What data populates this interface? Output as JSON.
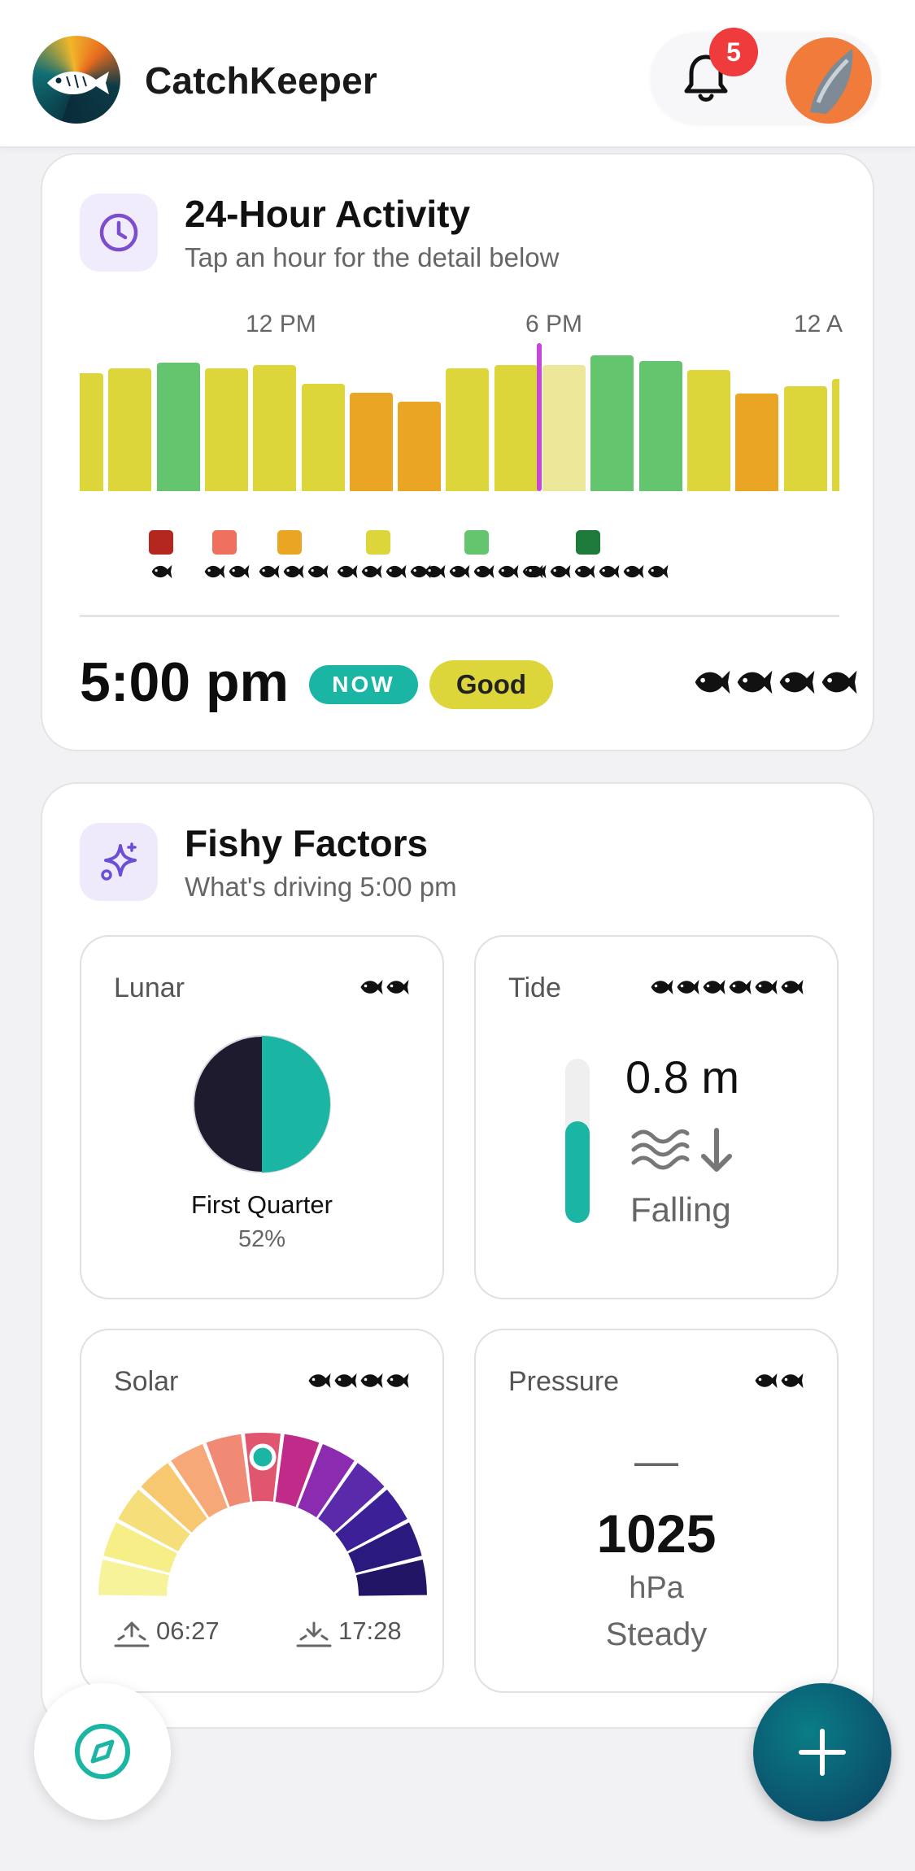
{
  "app": {
    "title": "CatchKeeper",
    "notification_count": "5"
  },
  "activity": {
    "title": "24-Hour Activity",
    "subtitle": "Tap an hour for the detail below",
    "time_labels": [
      "12 PM",
      "6 PM",
      "12 A"
    ],
    "bar_colors": {
      "good": "#dcd63a",
      "great": "#64c56e",
      "fair": "#e9a523",
      "now": "#ece799"
    },
    "bars": [
      {
        "level": 0.79,
        "tone": "good"
      },
      {
        "level": 0.82,
        "tone": "good"
      },
      {
        "level": 0.86,
        "tone": "great"
      },
      {
        "level": 0.82,
        "tone": "good"
      },
      {
        "level": 0.84,
        "tone": "good"
      },
      {
        "level": 0.72,
        "tone": "good"
      },
      {
        "level": 0.66,
        "tone": "fair"
      },
      {
        "level": 0.6,
        "tone": "fair"
      },
      {
        "level": 0.82,
        "tone": "good"
      },
      {
        "level": 0.84,
        "tone": "good"
      },
      {
        "level": 0.84,
        "tone": "now"
      },
      {
        "level": 0.91,
        "tone": "great"
      },
      {
        "level": 0.87,
        "tone": "great"
      },
      {
        "level": 0.81,
        "tone": "good"
      },
      {
        "level": 0.65,
        "tone": "fair"
      },
      {
        "level": 0.7,
        "tone": "good"
      },
      {
        "level": 0.75,
        "tone": "good"
      }
    ],
    "legend": [
      {
        "color": "#b3271f",
        "fish": 1
      },
      {
        "color": "#f0705f",
        "fish": 2
      },
      {
        "color": "#e9a523",
        "fish": 3
      },
      {
        "color": "#dcd63a",
        "fish": 4
      },
      {
        "color": "#64c56e",
        "fish": 5
      },
      {
        "color": "#1e7a3a",
        "fish": 6
      }
    ],
    "selected_time": "5:00 pm",
    "now_label": "NOW",
    "rating_label": "Good",
    "rating_fish": 4
  },
  "factors": {
    "title": "Fishy Factors",
    "subtitle": "What's driving 5:00 pm",
    "lunar": {
      "label": "Lunar",
      "fish": 2,
      "phase": "First Quarter",
      "illumination": "52%"
    },
    "tide": {
      "label": "Tide",
      "fish": 6,
      "height": "0.8 m",
      "trend": "Falling",
      "level": 0.62
    },
    "solar": {
      "label": "Solar",
      "fish": 4,
      "sunrise": "06:27",
      "sunset": "17:28"
    },
    "pressure": {
      "label": "Pressure",
      "fish": 2,
      "value": "1025",
      "unit": "hPa",
      "trend": "Steady",
      "trend_glyph": "—"
    }
  },
  "colors": {
    "accent": "#1bb6a3",
    "purple": "#7c4dce",
    "fab": "#0b5f73"
  }
}
